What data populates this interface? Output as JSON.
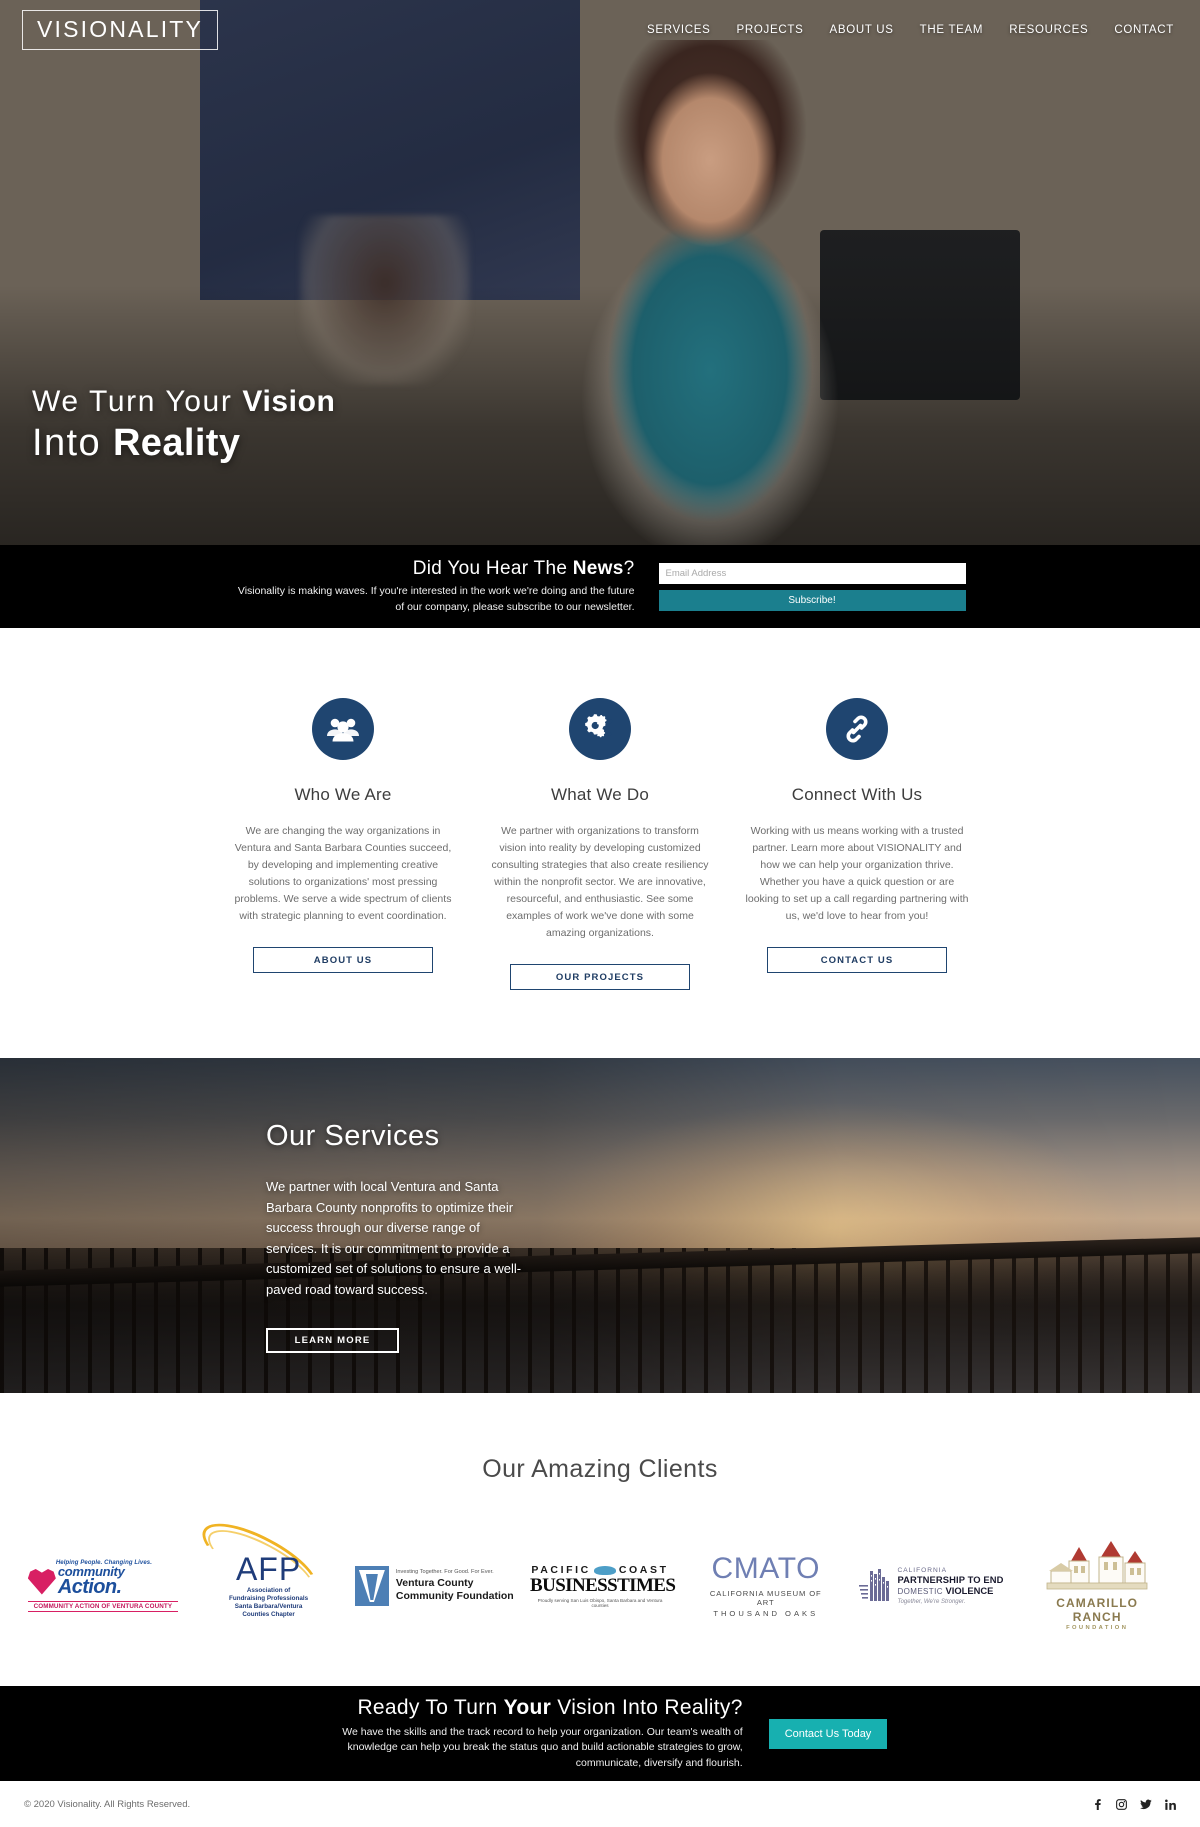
{
  "header": {
    "logo": "VISIONALITY",
    "nav": [
      {
        "label": "SERVICES"
      },
      {
        "label": "PROJECTS"
      },
      {
        "label": "ABOUT US"
      },
      {
        "label": "THE TEAM"
      },
      {
        "label": "RESOURCES"
      },
      {
        "label": "CONTACT"
      }
    ]
  },
  "hero": {
    "line1_plain": "We Turn Your ",
    "line1_bold": "Vision",
    "line2_plain": "Into ",
    "line2_bold": "Reality"
  },
  "newsletter": {
    "title_plain_before": "Did You Hear The ",
    "title_bold": "News",
    "title_plain_after": "?",
    "subtitle": "Visionality is making waves. If you're interested in the work we're doing and the future of our company, please subscribe to our newsletter.",
    "email_placeholder": "Email Address",
    "email_value": "",
    "subscribe_label": "Subscribe!",
    "accent_color": "#1b7f8e"
  },
  "features": {
    "accent_color": "#1f4570",
    "items": [
      {
        "icon": "people-group-icon",
        "title": "Who We Are",
        "body": "We are changing the way organizations in Ventura and Santa Barbara Counties succeed, by developing and implementing creative solutions to organizations' most pressing problems. We serve a wide spectrum of clients with strategic planning to event coordination.",
        "button": "ABOUT US"
      },
      {
        "icon": "gears-icon",
        "title": "What We Do",
        "body": "We partner with organizations to transform vision into reality by developing customized consulting strategies that also create resiliency within the nonprofit sector. We are innovative, resourceful, and enthusiastic. See some examples of work we've done with some amazing organizations.",
        "button": "OUR PROJECTS"
      },
      {
        "icon": "link-chain-icon",
        "title": "Connect With Us",
        "body": "Working with us means working with a trusted partner. Learn more about VISIONALITY and how we can help your organization thrive. Whether you have a quick question or are looking to set up a call regarding partnering with us, we'd love to hear from you!",
        "button": "CONTACT US"
      }
    ]
  },
  "services": {
    "title": "Our Services",
    "body": "We partner with local Ventura and Santa Barbara County nonprofits to optimize their success through our diverse range of services. It is our commitment to provide a customized set of solutions to ensure a well-paved road toward success.",
    "button": "LEARN MORE"
  },
  "clients": {
    "title": "Our Amazing Clients",
    "logos": [
      {
        "name": "community-action-ventura-county",
        "tagline": "Helping People. Changing Lives.",
        "word1": "community",
        "word2": "Action.",
        "bar": "COMMUNITY ACTION OF VENTURA COUNTY"
      },
      {
        "name": "afp-santa-barbara-ventura-chapter",
        "letters": "AFP",
        "sub_line1": "Association of",
        "sub_line2": "Fundraising Professionals",
        "sub_line3": "Santa Barbara/Ventura",
        "sub_line4": "Counties Chapter"
      },
      {
        "name": "ventura-county-community-foundation",
        "tagline": "Investing Together. For Good. For Ever.",
        "line1": "Ventura County",
        "line2": "Community Foundation"
      },
      {
        "name": "pacific-coast-business-times",
        "top": "PACIFIC",
        "top2": "COAST",
        "main": "BUSINESSTIMES",
        "sub": "Proudly serving San Luis Obispo, Santa Barbara and Ventura counties"
      },
      {
        "name": "cmato-california-museum-of-art",
        "main": "CMATO",
        "line1": "CALIFORNIA MUSEUM OF ART",
        "line2": "THOUSAND OAKS"
      },
      {
        "name": "california-partnership-to-end-domestic-violence",
        "line1": "CALIFORNIA",
        "line2": "PARTNERSHIP TO END",
        "line3_plain": "DOMESTIC ",
        "line3_bold": "VIOLENCE",
        "line4": "Together, We're Stronger."
      },
      {
        "name": "camarillo-ranch-foundation",
        "line1": "CAMARILLO RANCH",
        "line2": "FOUNDATION"
      }
    ]
  },
  "cta": {
    "title_before": "Ready To Turn ",
    "title_bold": "Your",
    "title_after": " Vision Into Reality?",
    "subtitle": "We have the skills and the track record to help your organization. Our team's wealth of knowledge can help you break the status quo and build actionable strategies to grow, communicate, diversify and flourish.",
    "button": "Contact Us Today",
    "accent_color": "#17b0b0"
  },
  "footer": {
    "copyright": "© 2020 Visionality. All Rights Reserved.",
    "social": [
      {
        "name": "facebook-icon"
      },
      {
        "name": "instagram-icon"
      },
      {
        "name": "twitter-icon"
      },
      {
        "name": "linkedin-icon"
      }
    ]
  }
}
